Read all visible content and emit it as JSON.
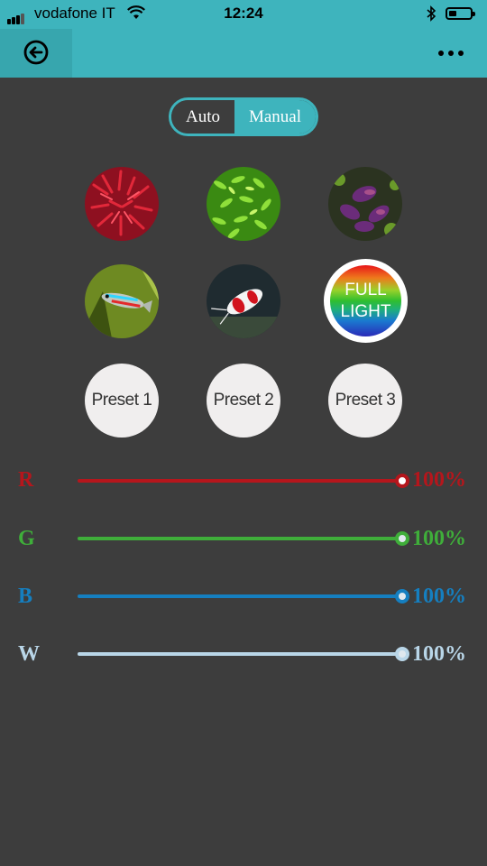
{
  "status_bar": {
    "carrier": "vodafone IT",
    "time": "12:24"
  },
  "header": {
    "back_icon": "back-arrow-circle-icon",
    "more_icon": "more-horizontal-icon"
  },
  "mode_toggle": {
    "auto_label": "Auto",
    "manual_label": "Manual",
    "selected": "Manual"
  },
  "presets": {
    "image_presets": [
      {
        "name": "red-plant"
      },
      {
        "name": "green-plant"
      },
      {
        "name": "purple-plant"
      },
      {
        "name": "neon-tetra-fish"
      },
      {
        "name": "crystal-red-shrimp"
      }
    ],
    "full_light_label_line1": "FULL",
    "full_light_label_line2": "LIGHT",
    "preset1_label": "Preset 1",
    "preset2_label": "Preset 2",
    "preset3_label": "Preset 3"
  },
  "channels": [
    {
      "label": "R",
      "value": "100%",
      "level": 1.0,
      "color": "#b5161c"
    },
    {
      "label": "G",
      "value": "100%",
      "level": 1.0,
      "color": "#3fae3a"
    },
    {
      "label": "B",
      "value": "100%",
      "level": 1.0,
      "color": "#157fc0"
    },
    {
      "label": "W",
      "value": "100%",
      "level": 1.0,
      "color": "#b9d6e8"
    }
  ],
  "colors": {
    "accent": "#3eb4bd",
    "background": "#3d3d3d"
  }
}
